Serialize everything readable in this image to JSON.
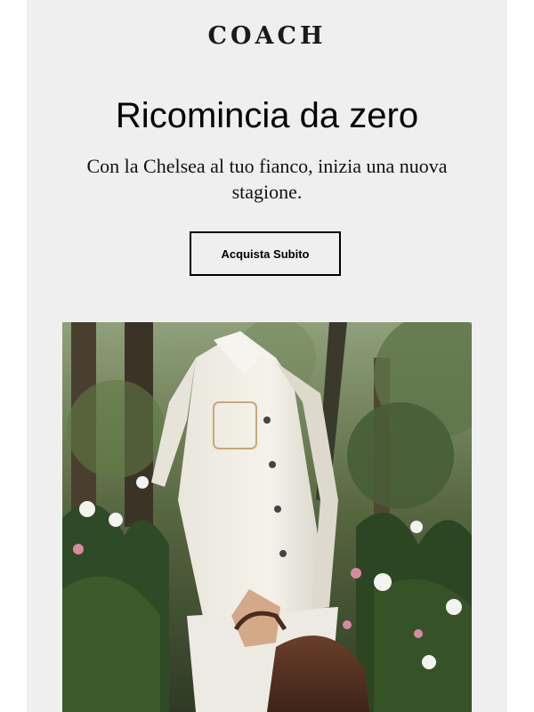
{
  "brand": {
    "logo_text": "COACH"
  },
  "hero": {
    "headline": "Ricomincia da zero",
    "subhead": "Con la Chelsea al tuo fianco, inizia una nuova stagione.",
    "cta_label": "Acquista Subito"
  },
  "colors": {
    "background": "#efefef",
    "text": "#000000",
    "button_border": "#000000"
  }
}
